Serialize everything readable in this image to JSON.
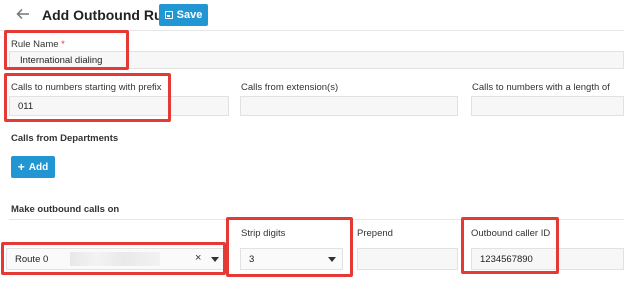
{
  "header": {
    "title": "Add Outbound Rule",
    "save_label": "Save"
  },
  "form": {
    "rule_name_label": "Rule Name",
    "rule_name_required_mark": "*",
    "rule_name_value": "International dialing",
    "prefix_label": "Calls to numbers starting with prefix",
    "prefix_value": "011",
    "extension_label": "Calls from extension(s)",
    "length_label": "Calls to numbers with a length of",
    "departments_heading": "Calls from Departments",
    "add_label": "Add",
    "outbound_heading": "Make outbound calls on",
    "strip_digits_label": "Strip digits",
    "strip_digits_value": "3",
    "prepend_label": "Prepend",
    "caller_id_label": "Outbound caller ID",
    "caller_id_value": "1234567890",
    "route_label": "Route 0",
    "route_clear_glyph": "×"
  },
  "icons": {
    "back": "arrow-left-icon",
    "save": "floppy-disk-icon",
    "add": "plus-icon",
    "dropdown": "caret-down-icon",
    "clear": "close-icon"
  },
  "colors": {
    "accent": "#2196d3",
    "highlight": "#e53935"
  }
}
